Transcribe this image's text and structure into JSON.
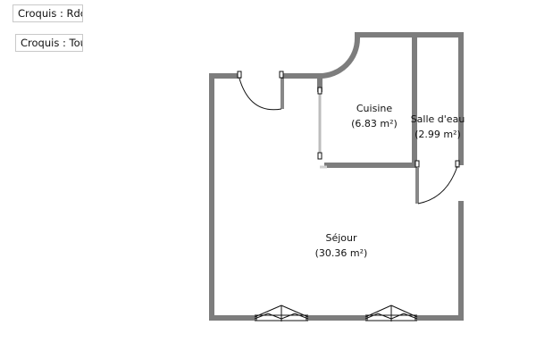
{
  "tabs": [
    {
      "label": "Croquis : Rdc"
    },
    {
      "label": "Croquis : Tous"
    }
  ],
  "rooms": [
    {
      "name": "Cuisine",
      "area": "(6.83 m²)"
    },
    {
      "name": "Salle d'eau",
      "area": "(2.99 m²)"
    },
    {
      "name": "Séjour",
      "area": "(30.36 m²)"
    }
  ],
  "colors": {
    "wall": "#7d7d7d",
    "door": "#111111",
    "wall_light": "#bdbdbd"
  }
}
